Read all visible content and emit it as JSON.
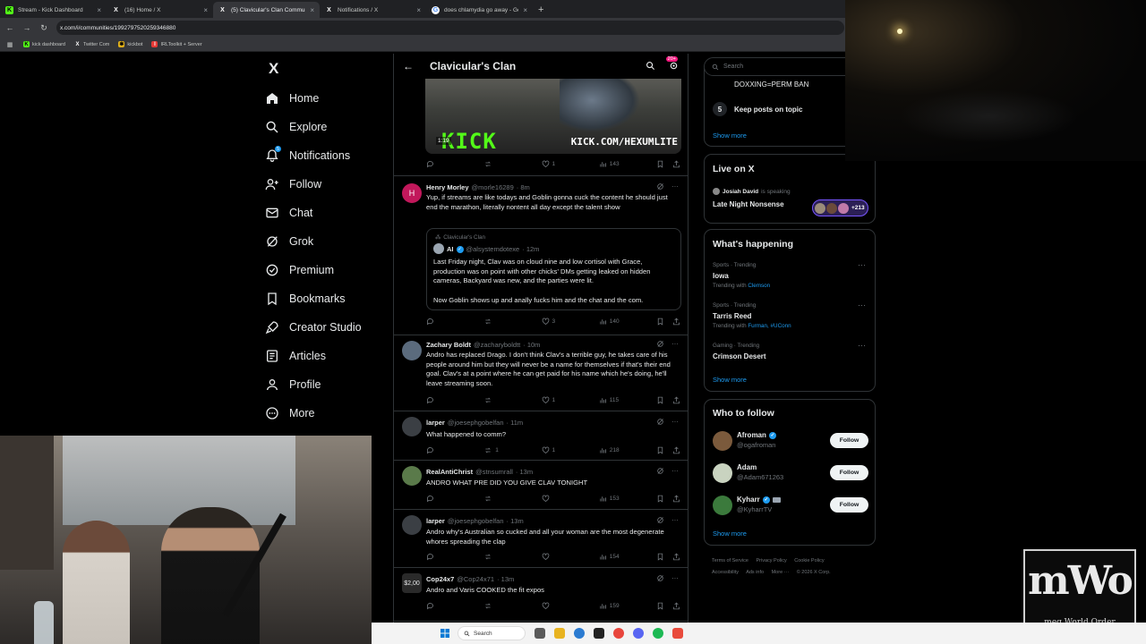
{
  "browser": {
    "tabs": [
      {
        "title": "Stream - Kick Dashboard",
        "icon": "kick-icon",
        "active": false
      },
      {
        "title": "(16) Home / X",
        "icon": "x-icon",
        "active": false
      },
      {
        "title": "(5) Clavicular's Clan Community",
        "icon": "x-icon",
        "active": true
      },
      {
        "title": "Notifications / X",
        "icon": "x-icon",
        "active": false
      },
      {
        "title": "does chlamydia go away - Google",
        "icon": "google-icon",
        "active": false
      }
    ],
    "new_tab": "+",
    "close_glyph": "×",
    "url": "x.com/i/communities/1992797520259346880",
    "bookmarks": [
      {
        "label": "kick dashboard",
        "icon": "kick-icon"
      },
      {
        "label": "Twitter Com",
        "icon": "x-icon"
      },
      {
        "label": "kickbot",
        "icon": "bot-icon"
      },
      {
        "label": "IRLToolkit + Server",
        "icon": "toolkit-icon"
      }
    ]
  },
  "nav": {
    "logo": "X",
    "items": [
      {
        "label": "Home",
        "icon": "home-icon"
      },
      {
        "label": "Explore",
        "icon": "search-icon"
      },
      {
        "label": "Notifications",
        "icon": "bell-icon",
        "badge": "5"
      },
      {
        "label": "Follow",
        "icon": "person-plus-icon"
      },
      {
        "label": "Chat",
        "icon": "mail-icon"
      },
      {
        "label": "Grok",
        "icon": "grok-icon"
      },
      {
        "label": "Premium",
        "icon": "premium-icon"
      },
      {
        "label": "Bookmarks",
        "icon": "bookmark-icon"
      },
      {
        "label": "Creator Studio",
        "icon": "rocket-icon"
      },
      {
        "label": "Articles",
        "icon": "article-icon"
      },
      {
        "label": "Profile",
        "icon": "person-icon"
      },
      {
        "label": "More",
        "icon": "more-circle-icon"
      }
    ]
  },
  "feed": {
    "back": "←",
    "title": "Clavicular's Clan",
    "header_badge": "20+",
    "media": {
      "duration": "1:19",
      "logo_text": "KICK",
      "url_text": "KICK.COM/HEXUMLITE"
    },
    "media_actions": {
      "replies": "",
      "reposts": "",
      "likes": "1",
      "views": "143"
    },
    "tweets": [
      {
        "name": "Henry Morley",
        "handle": "@morle16289",
        "time": "· 8m",
        "text": "Yup, if streams are like todays and Goblin gonna cuck the content he should just end the marathon, literally nontent all day except the talent show",
        "quote": {
          "context": "Clavicular's Clan",
          "name": "AI",
          "handle": "@alsystemdotexe",
          "time": "· 12m",
          "text1": "Last Friday night, Clav was on cloud nine and low cortisol with Grace, production was on point with other chicks' DMs getting leaked on hidden cameras, Backyard was new, and the parties were lit.",
          "text2": "Now Goblin shows up and anally fucks him and the chat and the com."
        },
        "replies": "",
        "reposts": "",
        "likes": "3",
        "views": "140",
        "avatar_letter": "H",
        "avatar_color": "#c2185b"
      },
      {
        "name": "Zachary Boldt",
        "handle": "@zacharyboldtt",
        "time": "· 10m",
        "text": "Andro has replaced Drago. I don't think Clav's a terrible guy, he takes care of his people around him but they will never be a name for themselves if that's their end goal. Clav's at a point where he can get paid for his name which he's doing, he'll leave streaming soon.",
        "replies": "",
        "reposts": "",
        "likes": "1",
        "views": "115",
        "avatar_color": "#5b6b7d"
      },
      {
        "name": "larper",
        "handle": "@joesephgobelfan",
        "time": "· 11m",
        "text": "What happened to comm?",
        "replies": "",
        "reposts": "1",
        "likes": "1",
        "views": "218",
        "avatar_color": "#3b3f44"
      },
      {
        "name": "RealAntiChrist",
        "handle": "@stnsumrall",
        "time": "· 13m",
        "text": "ANDRO WHAT PRE DID YOU GIVE CLAV TONIGHT",
        "replies": "",
        "reposts": "",
        "likes": "",
        "views": "153",
        "avatar_color": "#5a7a4a"
      },
      {
        "name": "larper",
        "handle": "@joesephgobelfan",
        "time": "· 13m",
        "text": "Andro why's Australian so cucked and all your woman are the most degenerate whores spreading the clap",
        "replies": "",
        "reposts": "",
        "likes": "",
        "views": "154",
        "avatar_color": "#3b3f44"
      },
      {
        "name": "Cop24x7",
        "handle": "@Cop24x71",
        "time": "· 13m",
        "text": "Andro and Varis COOKED the fit expos",
        "replies": "",
        "reposts": "",
        "likes": "",
        "views": "159",
        "avatar_text": "$2,00",
        "avatar_color": "#2a2a2a"
      }
    ]
  },
  "sidebar": {
    "search_placeholder": "Search",
    "rules": {
      "partial": "DOXXING=PERM BAN",
      "rule_number": "5",
      "rule_text": "Keep posts on topic",
      "show_more": "Show more"
    },
    "live": {
      "title": "Live on X",
      "host": "Josiah David",
      "host_status": "is speaking",
      "space_title": "Late Night Nonsense",
      "listeners": "+213"
    },
    "happening": {
      "title": "What's happening",
      "trends": [
        {
          "category": "Sports · Trending",
          "name": "Iowa",
          "with_label": "Trending with",
          "with": "Clemson"
        },
        {
          "category": "Sports · Trending",
          "name": "Tarris Reed",
          "with_label": "Trending with",
          "with": "Furman, #UConn"
        },
        {
          "category": "Gaming · Trending",
          "name": "Crimson Desert",
          "with_label": "",
          "with": ""
        }
      ],
      "more_glyph": "···",
      "show_more": "Show more"
    },
    "who_to_follow": {
      "title": "Who to follow",
      "users": [
        {
          "name": "Afroman",
          "handle": "@ogafroman",
          "verified": true,
          "avatar_color": "#7b5a3c"
        },
        {
          "name": "Adam",
          "handle": "@Adam671263",
          "verified": false,
          "avatar_color": "#c9d3c0"
        },
        {
          "name": "Kyharr",
          "handle": "@KyharrTV",
          "verified": true,
          "avatar_color": "#3b7a3c"
        }
      ],
      "follow_label": "Follow",
      "show_more": "Show more"
    },
    "footer": [
      "Terms of Service",
      "Privacy Policy",
      "Cookie Policy",
      "Accessibility",
      "Ads info",
      "More ···",
      "© 2026 X Corp."
    ]
  },
  "overlay": {
    "mwo_logo": "mWo",
    "mwo_caption": "meg World Order"
  },
  "taskbar": {
    "search_label": "Search"
  },
  "colors": {
    "accent": "#1d9bf0",
    "background": "#000000",
    "kick_green": "#53fc18",
    "badge_pink": "#f91880"
  }
}
